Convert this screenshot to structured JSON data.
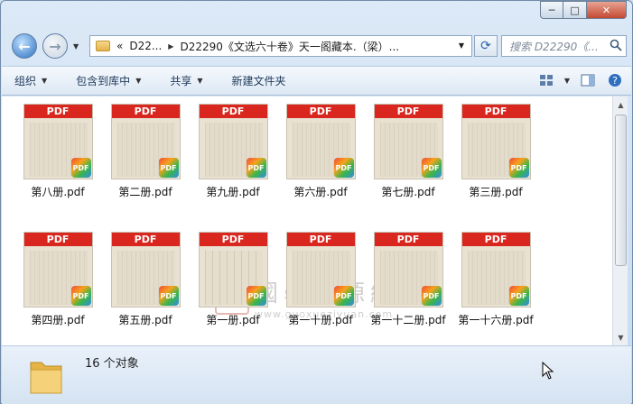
{
  "window": {
    "controls": {
      "minimize": "─",
      "maximize": "□",
      "close": "✕"
    }
  },
  "nav": {
    "breadcrumb": [
      "«",
      "D22...",
      "D22290《文选六十卷》天一阁藏本.（梁）..."
    ],
    "search_placeholder": "搜索 D22290《..."
  },
  "toolbar": {
    "items": [
      "组织",
      "包含到库中",
      "共享",
      "新建文件夹"
    ]
  },
  "files": [
    {
      "name": "第八册.pdf",
      "band": "PDF",
      "badge": "PDF"
    },
    {
      "name": "第二册.pdf",
      "band": "PDF",
      "badge": "PDF"
    },
    {
      "name": "第九册.pdf",
      "band": "PDF",
      "badge": "PDF"
    },
    {
      "name": "第六册.pdf",
      "band": "PDF",
      "badge": "PDF"
    },
    {
      "name": "第七册.pdf",
      "band": "PDF",
      "badge": "PDF"
    },
    {
      "name": "第三册.pdf",
      "band": "PDF",
      "badge": "PDF"
    },
    {
      "name": "第四册.pdf",
      "band": "PDF",
      "badge": "PDF"
    },
    {
      "name": "第五册.pdf",
      "band": "PDF",
      "badge": "PDF"
    },
    {
      "name": "第一册.pdf",
      "band": "PDF",
      "badge": "PDF"
    },
    {
      "name": "第一十册.pdf",
      "band": "PDF",
      "badge": "PDF"
    },
    {
      "name": "第一十二册.pdf",
      "band": "PDF",
      "badge": "PDF"
    },
    {
      "name": "第一十六册.pdf",
      "band": "PDF",
      "badge": "PDF"
    }
  ],
  "watermark": {
    "seal": "國",
    "text": "國學資源網",
    "url": "www.guoxueziyuan.com"
  },
  "status": {
    "count_text": "16 个对象"
  },
  "colors": {
    "pdf_band": "#d9261e",
    "accent": "#2c6fbf"
  }
}
